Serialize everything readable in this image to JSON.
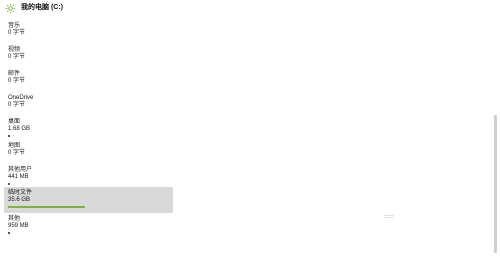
{
  "titlebar": {
    "title": "我的电脑 (C:)",
    "icon": "gear-icon",
    "icon_color": "#7cb342"
  },
  "items": [
    {
      "label": "音乐",
      "size": "0 字节",
      "fill_fraction": 0
    },
    {
      "label": "视频",
      "size": "0 字节",
      "fill_fraction": 0
    },
    {
      "label": "邮件",
      "size": "0 字节",
      "fill_fraction": 0
    },
    {
      "label": "OneDrive",
      "size": "0 字节",
      "fill_fraction": 0
    },
    {
      "label": "桌面",
      "size": "1.68 GB",
      "fill_fraction": 0.02
    },
    {
      "label": "地图",
      "size": "0 字节",
      "fill_fraction": 0
    },
    {
      "label": "其他用户",
      "size": "441 MB",
      "fill_fraction": 0.01
    },
    {
      "label": "临时文件",
      "size": "35.6 GB",
      "fill_fraction": 1.0,
      "selected": true
    },
    {
      "label": "其他",
      "size": "959 MB",
      "fill_fraction": 0.02
    }
  ],
  "colors": {
    "accent": "#7cb342",
    "selected_bg": "#d9d9d9",
    "small_bar": "#555555"
  }
}
